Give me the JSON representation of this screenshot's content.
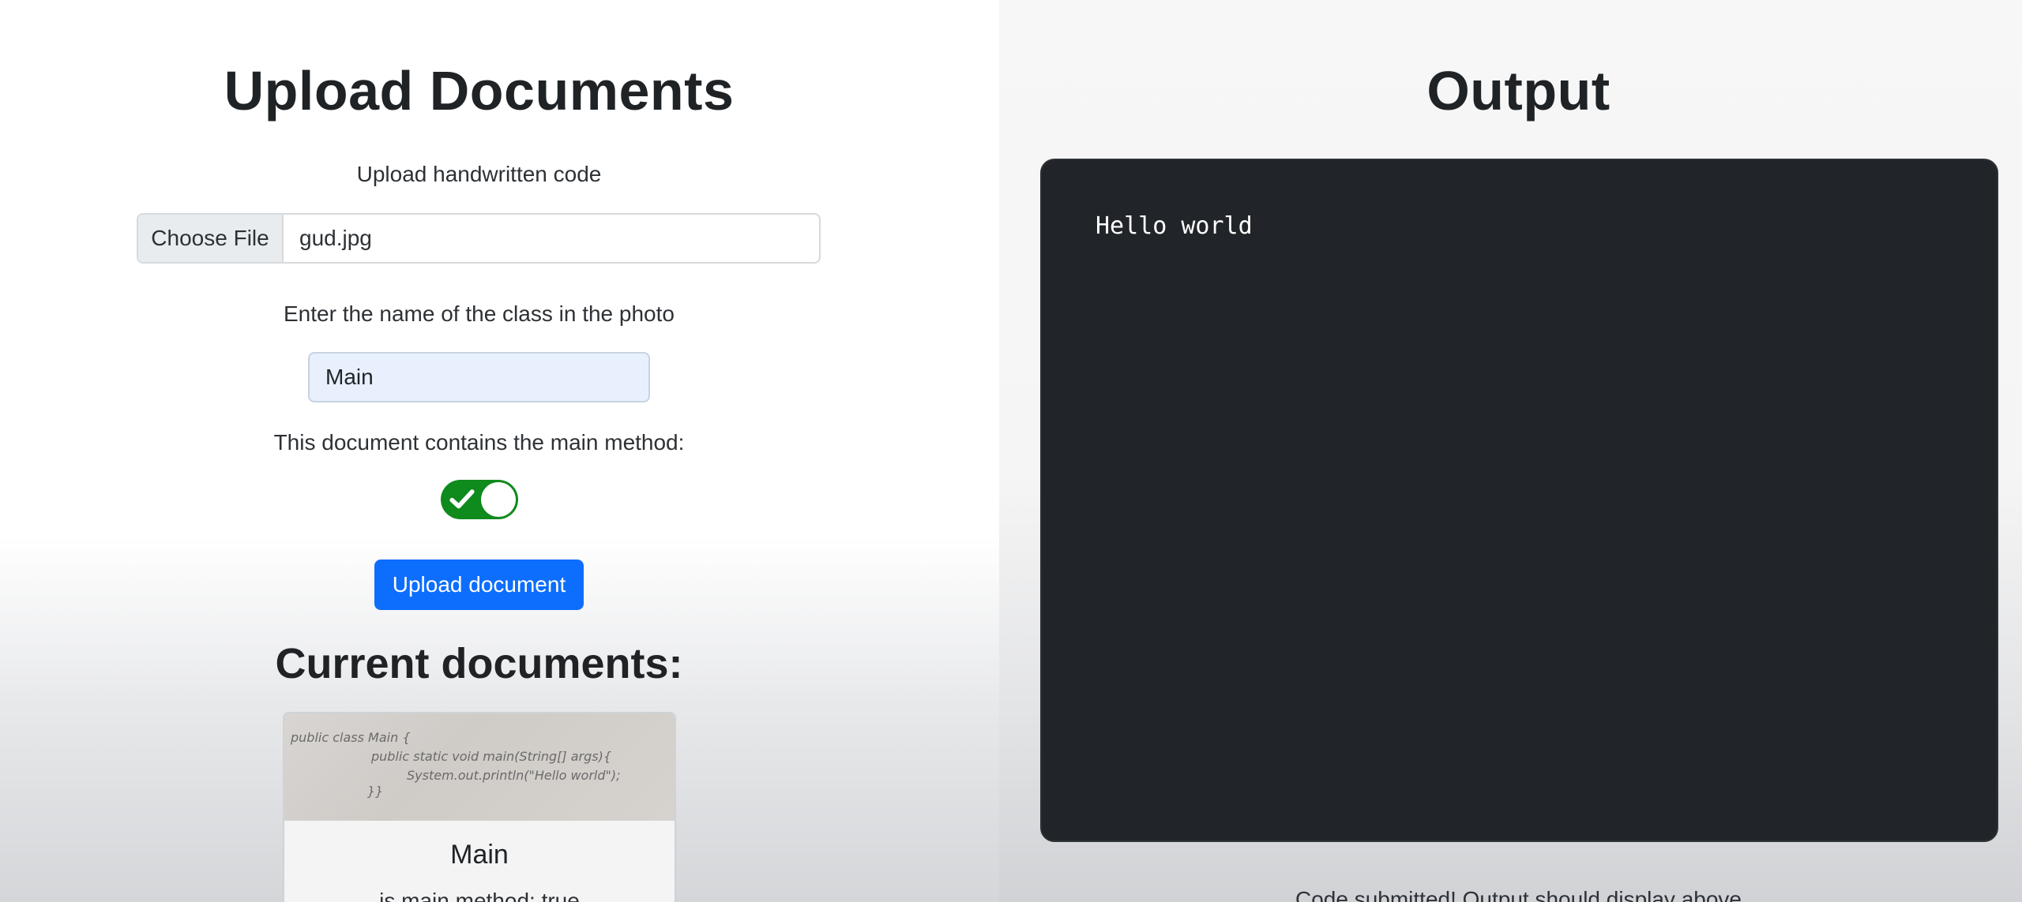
{
  "upload": {
    "title": "Upload Documents",
    "file_label": "Upload handwritten code",
    "file_button": "Choose File",
    "file_name": "gud.jpg",
    "class_label": "Enter the name of the class in the photo",
    "class_value": "Main",
    "main_method_label": "This document contains the main method:",
    "main_method_toggle": "on",
    "upload_button": "Upload document",
    "current_title": "Current documents:",
    "documents": [
      {
        "title": "Main",
        "meta": "is main method: true",
        "thumb_lines": [
          "public class Main {",
          "public static void main(String[] args){",
          "System.out.println(\"Hello world\");",
          "}}"
        ]
      }
    ]
  },
  "output": {
    "title": "Output",
    "console_text": "Hello world",
    "status_message": "Code submitted! Output should display above"
  },
  "colors": {
    "primary": "#0d6efd",
    "toggle_on": "#0f8a1c",
    "console_bg": "#212529"
  },
  "icons": {
    "toggle": "checkmark-icon"
  }
}
